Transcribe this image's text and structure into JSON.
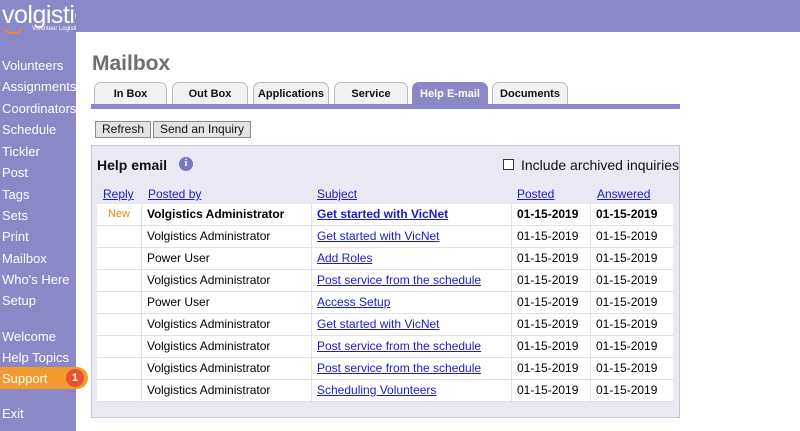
{
  "brand": {
    "name": "volgistics",
    "tagline": "Volunteer Logistics",
    "mark": "®",
    "accent": "#f08a1c"
  },
  "sidebar": {
    "items": [
      {
        "label": "Volunteers"
      },
      {
        "label": "Assignments"
      },
      {
        "label": "Coordinators"
      },
      {
        "label": "Schedule"
      },
      {
        "label": "Tickler"
      },
      {
        "label": "Post"
      },
      {
        "label": "Tags"
      },
      {
        "label": "Sets"
      },
      {
        "label": "Print"
      },
      {
        "label": "Mailbox"
      },
      {
        "label": "Who's Here"
      },
      {
        "label": "Setup"
      },
      {
        "label": "Welcome"
      },
      {
        "label": "Help Topics"
      },
      {
        "label": "Support",
        "active": true,
        "badge": "1"
      },
      {
        "label": "Exit"
      }
    ],
    "color": "#8a88c6",
    "active_color": "#f39a2e"
  },
  "page": {
    "title": "Mailbox"
  },
  "tabs": [
    {
      "label": "In Box"
    },
    {
      "label": "Out Box"
    },
    {
      "label": "Applications"
    },
    {
      "label": "Service"
    },
    {
      "label": "Help E-mail",
      "active": true
    },
    {
      "label": "Documents"
    }
  ],
  "toolbar": {
    "refresh_label": "Refresh",
    "inquiry_label": "Send an Inquiry"
  },
  "help": {
    "title": "Help email",
    "info_icon": "i",
    "archive_label": "Include archived inquiries",
    "columns": {
      "reply": "Reply",
      "posted_by": "Posted by",
      "subject": "Subject",
      "posted": "Posted",
      "answered": "Answered"
    },
    "rows": [
      {
        "reply": "New",
        "posted_by": "Volgistics Administrator",
        "subject": "Get started with VicNet",
        "posted": "01-15-2019",
        "answered": "01-15-2019",
        "bold": true
      },
      {
        "reply": "",
        "posted_by": "Volgistics Administrator",
        "subject": "Get started with VicNet",
        "posted": "01-15-2019",
        "answered": "01-15-2019"
      },
      {
        "reply": "",
        "posted_by": "Power User",
        "subject": "Add Roles",
        "posted": "01-15-2019",
        "answered": "01-15-2019"
      },
      {
        "reply": "",
        "posted_by": "Volgistics Administrator",
        "subject": "Post service from the schedule",
        "posted": "01-15-2019",
        "answered": "01-15-2019"
      },
      {
        "reply": "",
        "posted_by": "Power User",
        "subject": "Access Setup",
        "posted": "01-15-2019",
        "answered": "01-15-2019"
      },
      {
        "reply": "",
        "posted_by": "Volgistics Administrator",
        "subject": "Get started with VicNet",
        "posted": "01-15-2019",
        "answered": "01-15-2019"
      },
      {
        "reply": "",
        "posted_by": "Volgistics Administrator",
        "subject": "Post service from the schedule",
        "posted": "01-15-2019",
        "answered": "01-15-2019"
      },
      {
        "reply": "",
        "posted_by": "Volgistics Administrator",
        "subject": "Post service from the schedule",
        "posted": "01-15-2019",
        "answered": "01-15-2019"
      },
      {
        "reply": "",
        "posted_by": "Volgistics Administrator",
        "subject": "Scheduling Volunteers",
        "posted": "01-15-2019",
        "answered": "01-15-2019"
      }
    ]
  }
}
